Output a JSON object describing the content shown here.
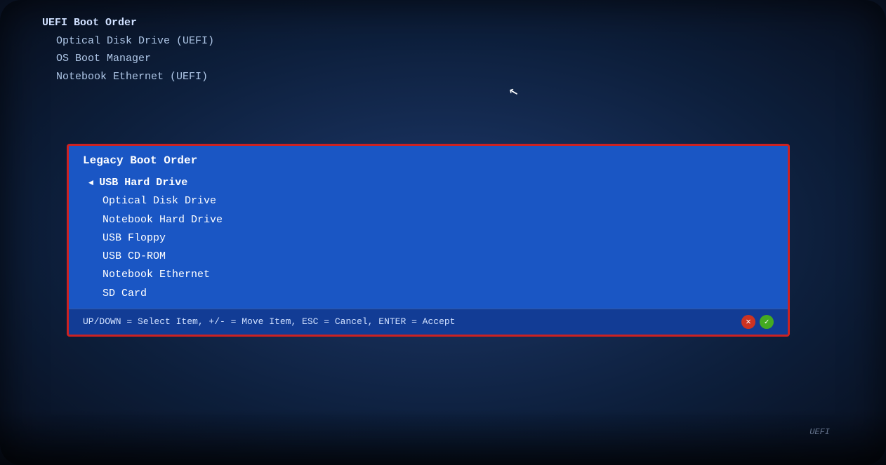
{
  "screen": {
    "background_color": "#0d1f3c"
  },
  "uefi_section": {
    "title": "UEFI Boot Order",
    "items": [
      {
        "label": "Optical Disk Drive (UEFI)"
      },
      {
        "label": "OS Boot Manager"
      },
      {
        "label": "Notebook Ethernet (UEFI)"
      }
    ]
  },
  "legacy_dialog": {
    "title": "Legacy Boot Order",
    "items": [
      {
        "label": "USB Hard Drive",
        "selected": true,
        "arrow": true
      },
      {
        "label": "Optical Disk Drive",
        "selected": false,
        "arrow": false
      },
      {
        "label": "Notebook Hard Drive",
        "selected": false,
        "arrow": false
      },
      {
        "label": "USB Floppy",
        "selected": false,
        "arrow": false
      },
      {
        "label": "USB CD-ROM",
        "selected": false,
        "arrow": false
      },
      {
        "label": "Notebook Ethernet",
        "selected": false,
        "arrow": false
      },
      {
        "label": "SD Card",
        "selected": false,
        "arrow": false
      }
    ],
    "footer_text": "UP/DOWN = Select Item,  +/- = Move Item,   ESC = Cancel,   ENTER = Accept",
    "icon_x": "✕",
    "icon_check": "✓",
    "border_color": "#cc2222",
    "background_color": "#1a56c4"
  },
  "bios_logo": {
    "text": "UEFI"
  }
}
